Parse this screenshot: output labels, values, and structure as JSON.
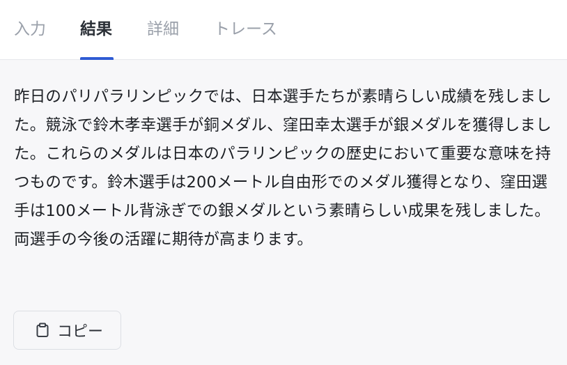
{
  "tabs": [
    {
      "label": "入力",
      "active": false
    },
    {
      "label": "結果",
      "active": true
    },
    {
      "label": "詳細",
      "active": false
    },
    {
      "label": "トレース",
      "active": false
    }
  ],
  "result": {
    "text": "昨日のパリパラリンピックでは、日本選手たちが素晴らしい成績を残しました。競泳で鈴木孝幸選手が銅メダル、窪田幸太選手が銀メダルを獲得しました。これらのメダルは日本のパラリンピックの歴史において重要な意味を持つものです。鈴木選手は200メートル自由形でのメダル獲得となり、窪田選手は100メートル背泳ぎでの銀メダルという素晴らしい成果を残しました。両選手の今後の活躍に期待が高まります。"
  },
  "copy_button": {
    "label": "コピー",
    "icon": "clipboard-icon"
  },
  "colors": {
    "accent": "#2f5bd3",
    "background": "#f7f7f9"
  }
}
